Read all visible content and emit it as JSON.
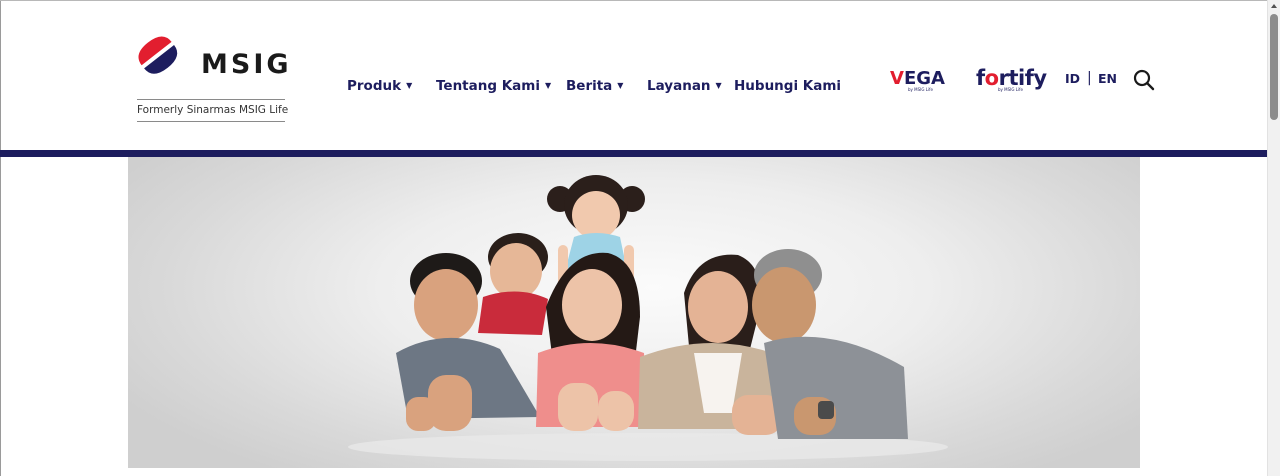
{
  "brand": {
    "name": "MSIG",
    "tagline": "Formerly Sinarmas MSIG Life",
    "colors": {
      "navy": "#1d1d5e",
      "red": "#e21e2f",
      "text": "#1d1d5e"
    }
  },
  "nav": {
    "items": [
      {
        "label": "Produk",
        "has_dropdown": true
      },
      {
        "label": "Tentang Kami",
        "has_dropdown": true
      },
      {
        "label": "Berita",
        "has_dropdown": true
      },
      {
        "label": "Layanan",
        "has_dropdown": true
      },
      {
        "label": "Hubungi Kami",
        "has_dropdown": false
      }
    ],
    "dropdown_icon": "caret-down-icon"
  },
  "partners": {
    "vega": {
      "label": "VEGA",
      "sub": "by MSIG Life"
    },
    "fortify": {
      "label": "fortify",
      "sub": "by MSIG Life"
    }
  },
  "language": {
    "options": [
      "ID",
      "EN"
    ],
    "separator": "|"
  },
  "search": {
    "icon": "search-icon"
  },
  "hero": {
    "image": "family-photo"
  }
}
